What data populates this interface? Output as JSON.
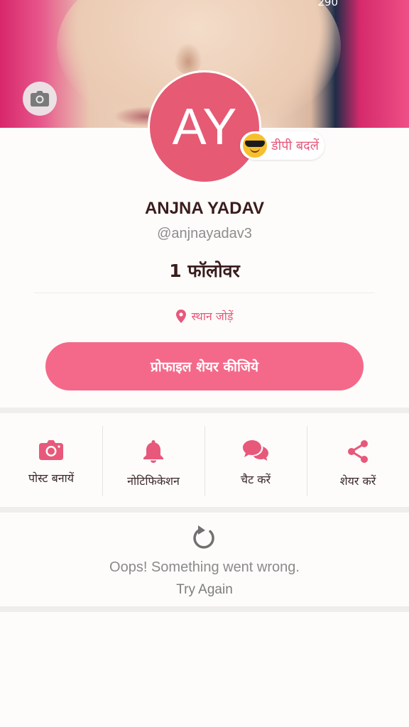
{
  "cover": {
    "count_text": "290"
  },
  "profile": {
    "initials": "AY",
    "change_dp_label": "डीपी बदलें",
    "name": "ANJNA YADAV",
    "handle": "@anjnayadav3",
    "followers": "1 फॉलोवर",
    "location_label": "स्थान जोड़ें",
    "share_button": "प्रोफाइल शेयर कीजिये"
  },
  "actions": [
    {
      "label": "पोस्ट बनायें",
      "icon": "camera-icon"
    },
    {
      "label": "नोटिफिकेशन",
      "icon": "bell-icon"
    },
    {
      "label": "चैट करें",
      "icon": "chat-icon"
    },
    {
      "label": "शेयर करें",
      "icon": "share-icon"
    }
  ],
  "error": {
    "icon": "refresh-icon",
    "message": "Oops! Something went wrong.",
    "retry_label": "Try Again"
  },
  "colors": {
    "accent": "#f4698a",
    "avatar_bg": "#e65a74",
    "icon_pink": "#e8587a"
  }
}
